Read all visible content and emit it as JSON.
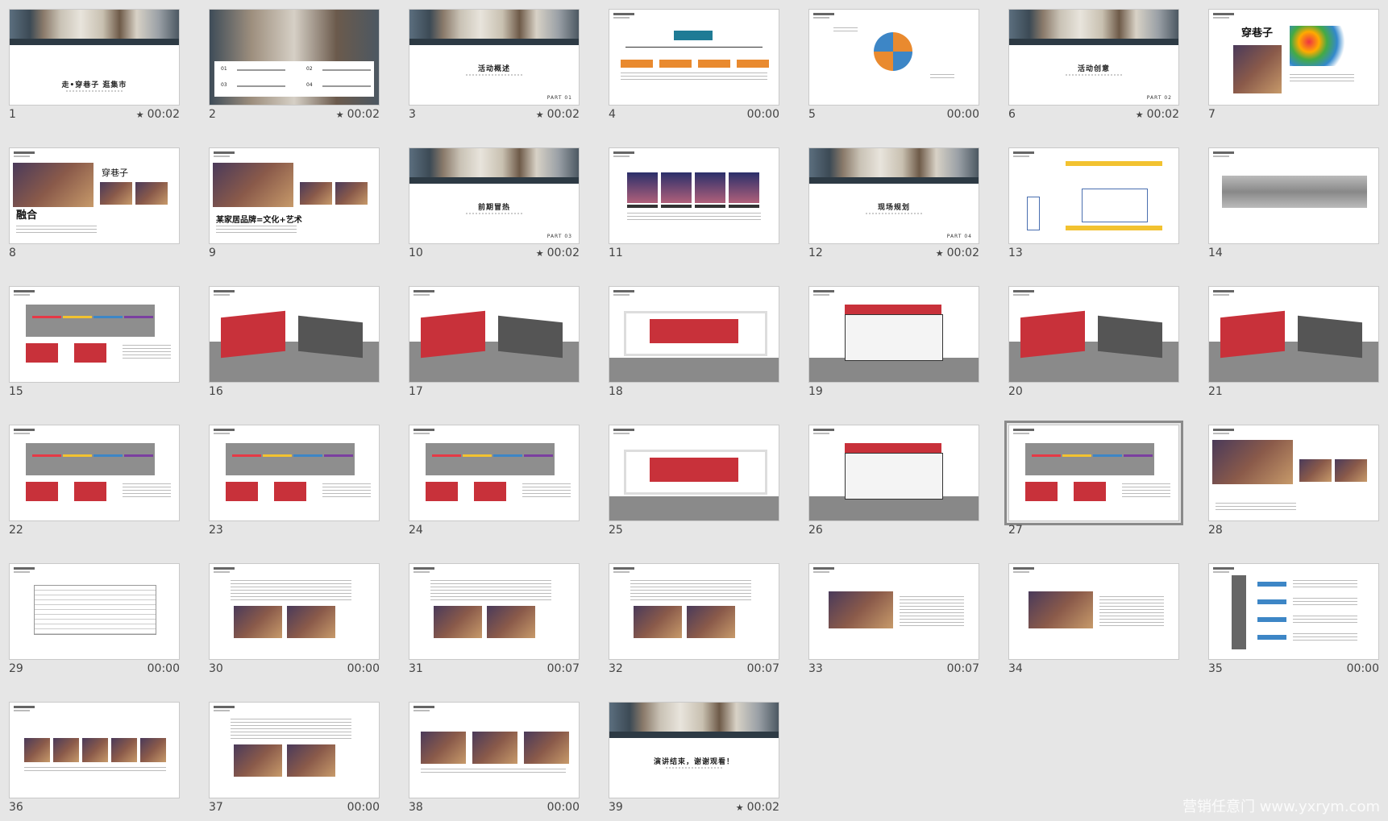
{
  "slides": [
    {
      "number": "1",
      "time": "00:02",
      "star": true,
      "title": "走•穿巷子 逛集市",
      "kind": "cover"
    },
    {
      "number": "2",
      "time": "00:02",
      "star": true,
      "kind": "toc",
      "toc": [
        "01",
        "02",
        "03",
        "04"
      ]
    },
    {
      "number": "3",
      "time": "00:02",
      "star": true,
      "title": "活动概述",
      "part": "PART 01",
      "kind": "section"
    },
    {
      "number": "4",
      "time": "00:00",
      "star": false,
      "kind": "orgchart"
    },
    {
      "number": "5",
      "time": "00:00",
      "star": false,
      "kind": "cycle"
    },
    {
      "number": "6",
      "time": "00:02",
      "star": true,
      "title": "活动创意",
      "part": "PART 02",
      "kind": "section"
    },
    {
      "number": "7",
      "time": "",
      "star": false,
      "title": "穿巷子",
      "kind": "map"
    },
    {
      "number": "8",
      "time": "",
      "star": false,
      "title": "融合",
      "title2": "穿巷子",
      "kind": "photos"
    },
    {
      "number": "9",
      "time": "",
      "star": false,
      "title": "某家居品牌=文化+艺术",
      "kind": "photos2"
    },
    {
      "number": "10",
      "time": "00:02",
      "star": true,
      "title": "前期冒热",
      "part": "PART 03",
      "kind": "section"
    },
    {
      "number": "11",
      "time": "",
      "star": false,
      "kind": "four"
    },
    {
      "number": "12",
      "time": "00:02",
      "star": true,
      "title": "现场规划",
      "part": "PART 04",
      "kind": "section"
    },
    {
      "number": "13",
      "time": "",
      "star": false,
      "kind": "plan"
    },
    {
      "number": "14",
      "time": "",
      "star": false,
      "kind": "corridor"
    },
    {
      "number": "15",
      "time": "",
      "star": false,
      "kind": "layout"
    },
    {
      "number": "16",
      "time": "",
      "star": false,
      "kind": "render"
    },
    {
      "number": "17",
      "time": "",
      "star": false,
      "kind": "render"
    },
    {
      "number": "18",
      "time": "",
      "star": false,
      "kind": "stage"
    },
    {
      "number": "19",
      "time": "",
      "star": false,
      "kind": "booth"
    },
    {
      "number": "20",
      "time": "",
      "star": false,
      "kind": "render"
    },
    {
      "number": "21",
      "time": "",
      "star": false,
      "kind": "render"
    },
    {
      "number": "22",
      "time": "",
      "star": false,
      "kind": "layout"
    },
    {
      "number": "23",
      "time": "",
      "star": false,
      "kind": "layout"
    },
    {
      "number": "24",
      "time": "",
      "star": false,
      "kind": "layout"
    },
    {
      "number": "25",
      "time": "",
      "star": false,
      "kind": "stage"
    },
    {
      "number": "26",
      "time": "",
      "star": false,
      "kind": "booth"
    },
    {
      "number": "27",
      "time": "",
      "star": false,
      "kind": "layout",
      "selected": true
    },
    {
      "number": "28",
      "time": "",
      "star": false,
      "kind": "photos"
    },
    {
      "number": "29",
      "time": "00:00",
      "star": false,
      "kind": "table"
    },
    {
      "number": "30",
      "time": "00:00",
      "star": false,
      "kind": "text2"
    },
    {
      "number": "31",
      "time": "00:07",
      "star": false,
      "kind": "text2"
    },
    {
      "number": "32",
      "time": "00:07",
      "star": false,
      "kind": "text2"
    },
    {
      "number": "33",
      "time": "00:07",
      "star": false,
      "kind": "text1"
    },
    {
      "number": "34",
      "time": "",
      "star": false,
      "kind": "text1"
    },
    {
      "number": "35",
      "time": "00:00",
      "star": false,
      "kind": "timeline"
    },
    {
      "number": "36",
      "time": "",
      "star": false,
      "kind": "five"
    },
    {
      "number": "37",
      "time": "00:00",
      "star": false,
      "kind": "text2"
    },
    {
      "number": "38",
      "time": "00:00",
      "star": false,
      "kind": "three"
    },
    {
      "number": "39",
      "time": "00:02",
      "star": true,
      "title": "演讲结束，谢谢观看！",
      "kind": "end"
    }
  ],
  "star_icon": "★",
  "watermark": "营销任意门 www.yxrym.com"
}
